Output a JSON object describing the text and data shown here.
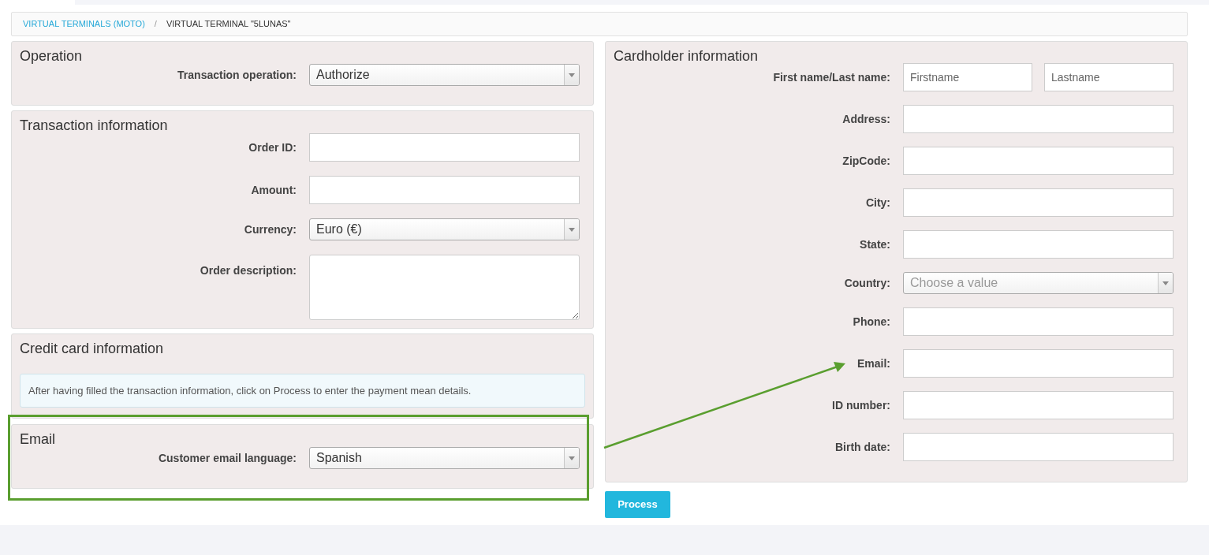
{
  "breadcrumb": [
    {
      "label": "VIRTUAL TERMINALS (MOTO)",
      "kind": "link"
    },
    {
      "label": "VIRTUAL TERMINAL \"5LUNAS\"",
      "kind": "current"
    }
  ],
  "breadcrumb_separator": "/",
  "left_panels": [
    {
      "title": "Operation",
      "fields": [
        {
          "label": "Transaction operation:",
          "kind": "select",
          "value": "Authorize"
        }
      ]
    },
    {
      "title": "Transaction information",
      "fields": [
        {
          "label": "Order ID:",
          "kind": "text"
        },
        {
          "label": "Amount:",
          "kind": "text"
        },
        {
          "label": "Currency:",
          "kind": "select",
          "value": "Euro (€)"
        },
        {
          "label": "Order description:",
          "kind": "textarea"
        }
      ]
    },
    {
      "title": "Credit card information",
      "notice": "After having filled the transaction information, click on Process to enter the payment mean details."
    },
    {
      "title": "Email",
      "highlighted": true,
      "fields": [
        {
          "label": "Customer email language:",
          "kind": "select",
          "value": "Spanish"
        }
      ]
    }
  ],
  "cardholder": {
    "title": "Cardholder information",
    "fields": [
      {
        "label": "First name/Last name:",
        "kind": "name_pair",
        "placeholders": [
          "Firstname",
          "Lastname"
        ]
      },
      {
        "label": "Address:",
        "kind": "text"
      },
      {
        "label": "ZipCode:",
        "kind": "text"
      },
      {
        "label": "City:",
        "kind": "text"
      },
      {
        "label": "State:",
        "kind": "text"
      },
      {
        "label": "Country:",
        "kind": "select",
        "placeholder": "Choose a value"
      },
      {
        "label": "Phone:",
        "kind": "text"
      },
      {
        "label": "Email:",
        "kind": "text"
      },
      {
        "label": "ID number:",
        "kind": "text"
      },
      {
        "label": "Birth date:",
        "kind": "text"
      }
    ]
  },
  "process_button": "Process"
}
